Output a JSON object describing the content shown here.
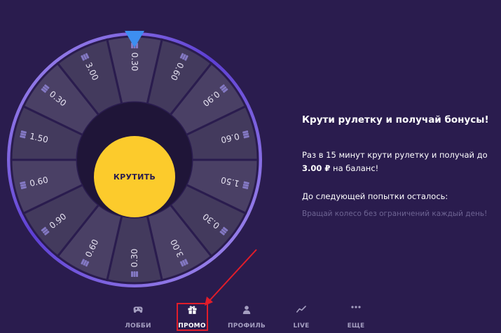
{
  "wheel": {
    "spin_label": "КРУТИТЬ",
    "segments": [
      "0.30",
      "0.60",
      "0.90",
      "0.60",
      "1.50",
      "0.30",
      "3.00",
      "0.30",
      "0.60",
      "0.90",
      "0.60",
      "1.50",
      "0.30",
      "3.00"
    ],
    "colors": {
      "segment": "#4a4065",
      "segment_alt": "#433a5d",
      "divider": "#2a1c4e",
      "hub": "#1f1538",
      "rim_light": "#a893f0",
      "rim_dark": "#5d3fd3",
      "pointer": "#3d8ef0",
      "coin": "#8479c4",
      "value_text": "#e7e3f2"
    }
  },
  "info": {
    "title": "Крути рулетку и получай бонусы!",
    "line1": "Раз в 15 минут крути рулетку и получай до",
    "amount": "3.00 ₽",
    "line2": " на баланс!",
    "next_try": "До следующей попытки осталось:",
    "note": "Вращай колесо без ограничений каждый день!"
  },
  "nav": {
    "items": [
      {
        "label": "ЛОББИ",
        "icon": "gamepad-icon"
      },
      {
        "label": "ПРОМО",
        "icon": "gift-icon",
        "active": true
      },
      {
        "label": "ПРОФИЛЬ",
        "icon": "user-icon"
      },
      {
        "label": "LIVE",
        "icon": "chart-icon"
      },
      {
        "label": "ЕЩЕ",
        "icon": "more-dots-icon"
      }
    ]
  },
  "annotation": {
    "color": "#e11d2a"
  }
}
